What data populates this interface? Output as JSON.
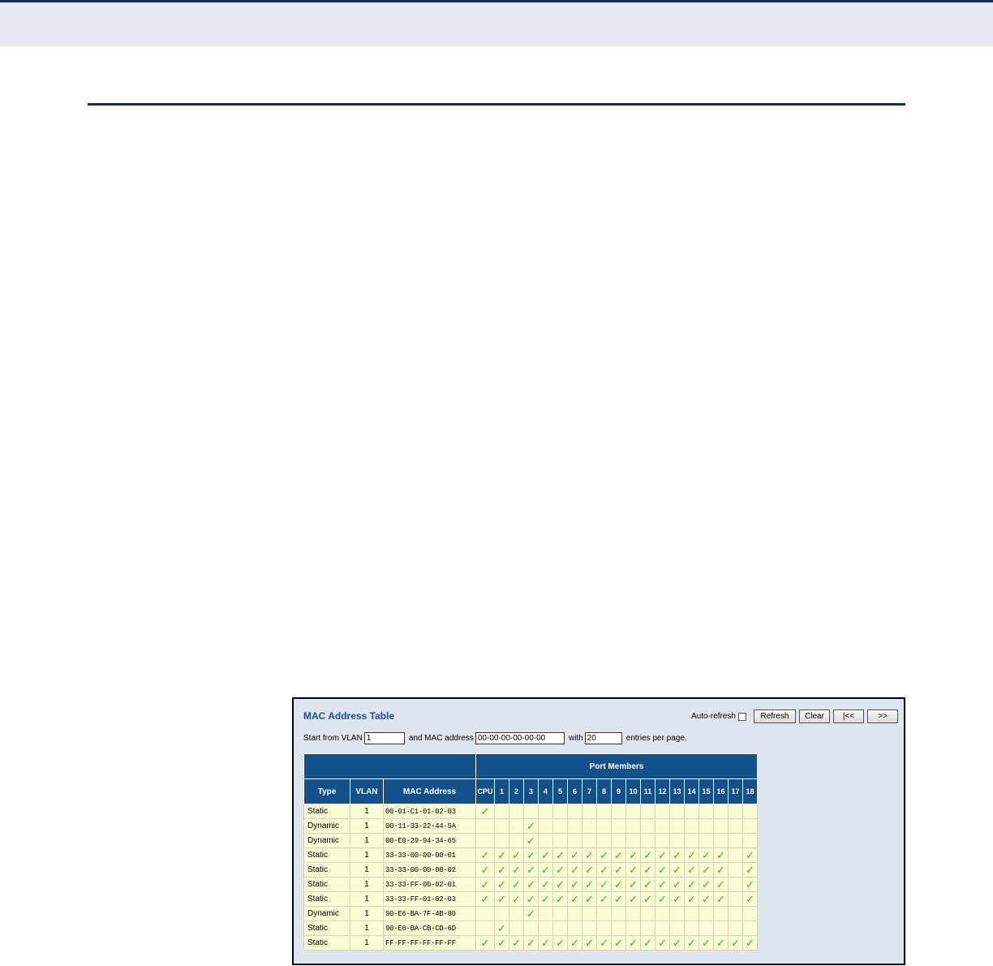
{
  "panel": {
    "title": "MAC Address Table",
    "auto_refresh_label": "Auto-refresh",
    "buttons": {
      "refresh": "Refresh",
      "clear": "Clear",
      "first": "|<<",
      "next": ">>"
    },
    "filter": {
      "start_label": "Start from VLAN",
      "vlan_value": "1",
      "mac_label": "and MAC address",
      "mac_value": "00-00-00-00-00-00",
      "with_label": "with",
      "entries_value": "20",
      "entries_label": "entries per page."
    }
  },
  "table": {
    "headers": {
      "type": "Type",
      "vlan": "VLAN",
      "mac": "MAC Address",
      "port_members": "Port Members"
    },
    "ports": [
      "CPU",
      "1",
      "2",
      "3",
      "4",
      "5",
      "6",
      "7",
      "8",
      "9",
      "10",
      "11",
      "12",
      "13",
      "14",
      "15",
      "16",
      "17",
      "18"
    ],
    "check_glyph": "✓",
    "rows": [
      {
        "type": "Static",
        "vlan": "1",
        "mac": "00-01-C1-01-02-03",
        "members": [
          1,
          0,
          0,
          0,
          0,
          0,
          0,
          0,
          0,
          0,
          0,
          0,
          0,
          0,
          0,
          0,
          0,
          0,
          0
        ]
      },
      {
        "type": "Dynamic",
        "vlan": "1",
        "mac": "00-11-33-22-44-5A",
        "members": [
          0,
          0,
          0,
          1,
          0,
          0,
          0,
          0,
          0,
          0,
          0,
          0,
          0,
          0,
          0,
          0,
          0,
          0,
          0
        ]
      },
      {
        "type": "Dynamic",
        "vlan": "1",
        "mac": "00-E0-29-94-34-65",
        "members": [
          0,
          0,
          0,
          1,
          0,
          0,
          0,
          0,
          0,
          0,
          0,
          0,
          0,
          0,
          0,
          0,
          0,
          0,
          0
        ]
      },
      {
        "type": "Static",
        "vlan": "1",
        "mac": "33-33-00-00-00-01",
        "members": [
          1,
          1,
          1,
          1,
          1,
          1,
          1,
          1,
          1,
          1,
          1,
          1,
          1,
          1,
          1,
          1,
          1,
          0,
          1
        ]
      },
      {
        "type": "Static",
        "vlan": "1",
        "mac": "33-33-00-00-00-02",
        "members": [
          1,
          1,
          1,
          1,
          1,
          1,
          1,
          1,
          1,
          1,
          1,
          1,
          1,
          1,
          1,
          1,
          1,
          0,
          1
        ]
      },
      {
        "type": "Static",
        "vlan": "1",
        "mac": "33-33-FF-00-02-01",
        "members": [
          1,
          1,
          1,
          1,
          1,
          1,
          1,
          1,
          1,
          1,
          1,
          1,
          1,
          1,
          1,
          1,
          1,
          0,
          1
        ]
      },
      {
        "type": "Static",
        "vlan": "1",
        "mac": "33-33-FF-01-02-03",
        "members": [
          1,
          1,
          1,
          1,
          1,
          1,
          1,
          1,
          1,
          1,
          1,
          1,
          1,
          1,
          1,
          1,
          1,
          0,
          1
        ]
      },
      {
        "type": "Dynamic",
        "vlan": "1",
        "mac": "90-E6-BA-7F-4B-80",
        "members": [
          0,
          0,
          0,
          1,
          0,
          0,
          0,
          0,
          0,
          0,
          0,
          0,
          0,
          0,
          0,
          0,
          0,
          0,
          0
        ]
      },
      {
        "type": "Static",
        "vlan": "1",
        "mac": "90-E6-BA-CB-CD-6D",
        "members": [
          0,
          1,
          0,
          0,
          0,
          0,
          0,
          0,
          0,
          0,
          0,
          0,
          0,
          0,
          0,
          0,
          0,
          0,
          0
        ]
      },
      {
        "type": "Static",
        "vlan": "1",
        "mac": "FF-FF-FF-FF-FF-FF",
        "members": [
          1,
          1,
          1,
          1,
          1,
          1,
          1,
          1,
          1,
          1,
          1,
          1,
          1,
          1,
          1,
          1,
          1,
          1,
          1
        ]
      }
    ]
  }
}
